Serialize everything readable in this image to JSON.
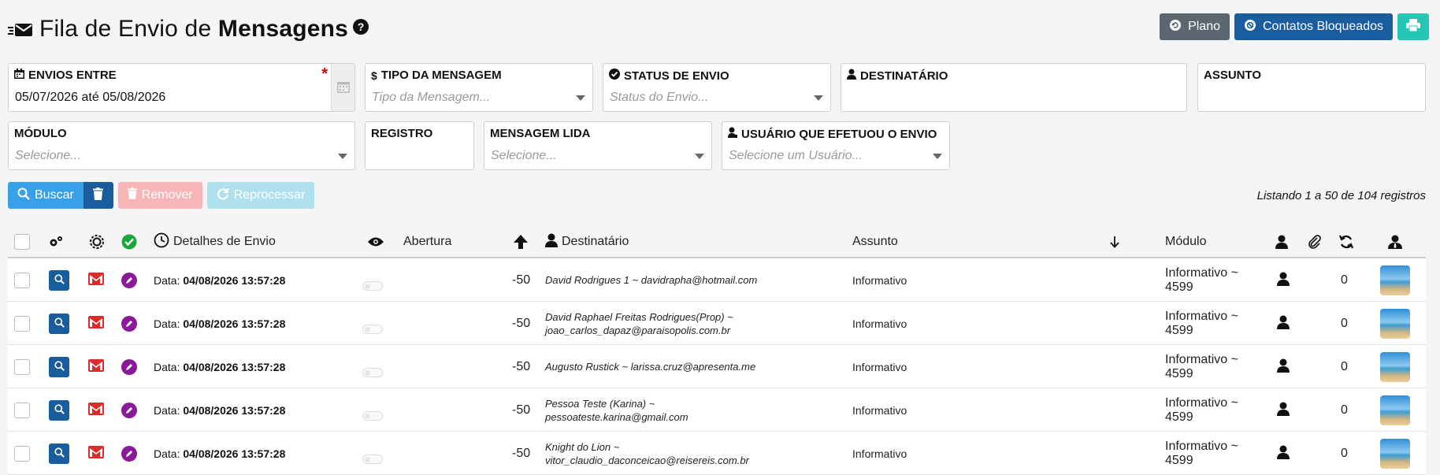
{
  "header": {
    "title_light": "Fila de Envio de",
    "title_bold": "Mensagens",
    "help": "?"
  },
  "top_buttons": {
    "plano": "Plano",
    "contatos": "Contatos Bloqueados"
  },
  "filters": {
    "envios_entre": {
      "label": "ENVIOS ENTRE",
      "value": "05/07/2026 até 05/08/2026",
      "required": "*"
    },
    "tipo": {
      "label": "TIPO DA MENSAGEM",
      "placeholder": "Tipo da Mensagem..."
    },
    "status": {
      "label": "STATUS DE ENVIO",
      "placeholder": "Status do Envio..."
    },
    "destinatario": {
      "label": "DESTINATÁRIO"
    },
    "assunto": {
      "label": "ASSUNTO"
    },
    "modulo": {
      "label": "MÓDULO",
      "placeholder": "Selecione..."
    },
    "registro": {
      "label": "REGISTRO"
    },
    "lida": {
      "label": "MENSAGEM LIDA",
      "placeholder": "Selecione..."
    },
    "usuario": {
      "label": "USUÁRIO QUE EFETUOU O ENVIO",
      "placeholder": "Selecione um Usuário..."
    }
  },
  "actions": {
    "buscar": "Buscar",
    "remover": "Remover",
    "reprocessar": "Reprocessar"
  },
  "listing": "Listando 1 a 50 de 104 registros",
  "columns": {
    "detalhes": "Detalhes de Envio",
    "abertura": "Abertura",
    "destinatario": "Destinatário",
    "assunto": "Assunto",
    "modulo": "Módulo"
  },
  "rows": [
    {
      "date_label": "Data:",
      "date": "04/08/2026 13:57:28",
      "score": "-50",
      "dest_line1": "David Rodrigues 1 ~ davidrapha@hotmail.com",
      "dest_line2": "",
      "assunto": "Informativo",
      "modulo_line1": "Informativo ~",
      "modulo_line2": "4599",
      "retries": "0"
    },
    {
      "date_label": "Data:",
      "date": "04/08/2026 13:57:28",
      "score": "-50",
      "dest_line1": "David Raphael Freitas Rodrigues(Prop) ~",
      "dest_line2": "joao_carlos_dapaz@paraisopolis.com.br",
      "assunto": "Informativo",
      "modulo_line1": "Informativo ~",
      "modulo_line2": "4599",
      "retries": "0"
    },
    {
      "date_label": "Data:",
      "date": "04/08/2026 13:57:28",
      "score": "-50",
      "dest_line1": "Augusto Rustick ~ larissa.cruz@apresenta.me",
      "dest_line2": "",
      "assunto": "Informativo",
      "modulo_line1": "Informativo ~",
      "modulo_line2": "4599",
      "retries": "0"
    },
    {
      "date_label": "Data:",
      "date": "04/08/2026 13:57:28",
      "score": "-50",
      "dest_line1": "Pessoa Teste (Karina) ~ pessoateste.karina@gmail.com",
      "dest_line2": "",
      "assunto": "Informativo",
      "modulo_line1": "Informativo ~",
      "modulo_line2": "4599",
      "retries": "0"
    },
    {
      "date_label": "Data:",
      "date": "04/08/2026 13:57:28",
      "score": "-50",
      "dest_line1": "Knight do Lion ~ vitor_claudio_daconceicao@reisereis.com.br",
      "dest_line2": "",
      "assunto": "Informativo",
      "modulo_line1": "Informativo ~",
      "modulo_line2": "4599",
      "retries": "0"
    }
  ]
}
